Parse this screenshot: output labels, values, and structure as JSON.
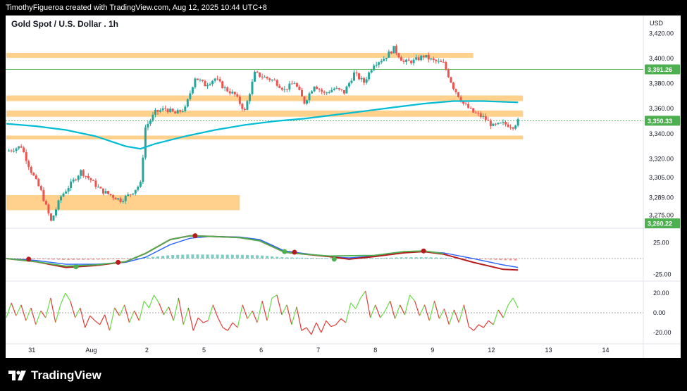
{
  "header": {
    "attribution": "TimothyFigueroa created with TradingView.com, Aug 12, 2025 10:44 UTC+8"
  },
  "footer": {
    "brand": "TradingView"
  },
  "colors": {
    "bull": "#26a69a",
    "bear": "#ef5350",
    "zone": "#ffcc80",
    "ema": "#00bcd4",
    "macd_fast": "#4caf50",
    "macd_signal": "#2962ff",
    "macd_slow": "#b71c1c",
    "osc_up": "#66dd44",
    "osc_down": "#e53935",
    "green_label": "#4caf50"
  },
  "chart_data": [
    {
      "type": "candlestick",
      "title": "Gold Spot / U.S. Dollar . 1h",
      "currency": "USD",
      "y_ticks": [
        "3,420.00",
        "3,400.00",
        "3,380.00",
        "3,360.00",
        "3,340.00",
        "3,320.00",
        "3,305.00",
        "3,289.00",
        "3,275.00"
      ],
      "price_labels": [
        {
          "text": "3,391.26",
          "value": 3391.26,
          "color": "#4caf50"
        },
        {
          "text": "3,350.33",
          "value": 3350.33,
          "color": "#4caf50"
        },
        {
          "text": "3,260.22",
          "value": 3260.22,
          "color": "#4caf50"
        }
      ],
      "x_ticks": [
        "31",
        "Aug",
        "2",
        "5",
        "6",
        "7",
        "8",
        "9",
        "12",
        "13",
        "14"
      ],
      "zones": [
        {
          "from": 3400.5,
          "to": 3404.5,
          "t_start": 0,
          "t_end": 94
        },
        {
          "from": 3366.0,
          "to": 3370.5,
          "t_start": 0,
          "t_end": 104
        },
        {
          "from": 3353.5,
          "to": 3358.5,
          "t_start": 0,
          "t_end": 104
        },
        {
          "from": 3335.5,
          "to": 3338.5,
          "t_start": 0,
          "t_end": 104
        },
        {
          "from": 3279.0,
          "to": 3291.0,
          "t_start": 0,
          "t_end": 47
        }
      ],
      "hlines": [
        {
          "value": 3391.26
        },
        {
          "value": 3350.33
        }
      ],
      "candles": {
        "waypoints": [
          [
            0,
            3326
          ],
          [
            3,
            3330
          ],
          [
            5,
            3310
          ],
          [
            7,
            3294
          ],
          [
            9,
            3270
          ],
          [
            11,
            3290
          ],
          [
            13,
            3300
          ],
          [
            15,
            3310
          ],
          [
            17,
            3303
          ],
          [
            19,
            3295
          ],
          [
            21,
            3291
          ],
          [
            23,
            3287
          ],
          [
            25,
            3292
          ],
          [
            27,
            3300
          ],
          [
            28,
            3345
          ],
          [
            30,
            3357
          ],
          [
            32,
            3360
          ],
          [
            34,
            3356
          ],
          [
            36,
            3360
          ],
          [
            38,
            3385
          ],
          [
            40,
            3379
          ],
          [
            42,
            3384
          ],
          [
            44,
            3376
          ],
          [
            46,
            3371
          ],
          [
            48,
            3358
          ],
          [
            50,
            3388
          ],
          [
            52,
            3385
          ],
          [
            54,
            3382
          ],
          [
            56,
            3375
          ],
          [
            58,
            3381
          ],
          [
            60,
            3365
          ],
          [
            62,
            3379
          ],
          [
            64,
            3372
          ],
          [
            66,
            3376
          ],
          [
            68,
            3373
          ],
          [
            70,
            3388
          ],
          [
            72,
            3381
          ],
          [
            74,
            3396
          ],
          [
            76,
            3400
          ],
          [
            78,
            3408
          ],
          [
            80,
            3397
          ],
          [
            82,
            3398
          ],
          [
            84,
            3402
          ],
          [
            86,
            3398
          ],
          [
            88,
            3396
          ],
          [
            90,
            3377
          ],
          [
            92,
            3364
          ],
          [
            94,
            3357
          ],
          [
            96,
            3353
          ],
          [
            98,
            3346
          ],
          [
            100,
            3348
          ],
          [
            102,
            3346
          ],
          [
            103,
            3350
          ]
        ]
      },
      "ema": [
        [
          0,
          3348
        ],
        [
          6,
          3346
        ],
        [
          12,
          3343
        ],
        [
          18,
          3338
        ],
        [
          24,
          3330
        ],
        [
          27,
          3328
        ],
        [
          30,
          3332
        ],
        [
          36,
          3338
        ],
        [
          42,
          3343
        ],
        [
          48,
          3347
        ],
        [
          54,
          3350
        ],
        [
          60,
          3352
        ],
        [
          66,
          3355
        ],
        [
          72,
          3358
        ],
        [
          78,
          3361
        ],
        [
          84,
          3364
        ],
        [
          90,
          3366
        ],
        [
          96,
          3366
        ],
        [
          103,
          3365
        ]
      ]
    },
    {
      "type": "line",
      "name": "macd",
      "y_ticks": [
        "25.00",
        "-25.00"
      ],
      "zero_line": 0,
      "fast": [
        [
          0,
          0
        ],
        [
          6,
          -5
        ],
        [
          12,
          -12
        ],
        [
          18,
          -10
        ],
        [
          24,
          -5
        ],
        [
          28,
          8
        ],
        [
          33,
          30
        ],
        [
          37,
          36
        ],
        [
          41,
          35
        ],
        [
          47,
          33
        ],
        [
          51,
          28
        ],
        [
          56,
          10
        ],
        [
          60,
          7
        ],
        [
          65,
          4
        ],
        [
          69,
          0
        ],
        [
          74,
          5
        ],
        [
          80,
          11
        ],
        [
          84,
          12
        ],
        [
          88,
          8
        ],
        [
          94,
          -3
        ],
        [
          100,
          -14
        ],
        [
          103,
          -17
        ]
      ],
      "signal": [
        [
          0,
          0
        ],
        [
          6,
          -3
        ],
        [
          12,
          -9
        ],
        [
          18,
          -9
        ],
        [
          24,
          -6
        ],
        [
          28,
          2
        ],
        [
          33,
          22
        ],
        [
          37,
          32
        ],
        [
          41,
          35
        ],
        [
          47,
          34
        ],
        [
          51,
          30
        ],
        [
          56,
          12
        ],
        [
          60,
          8
        ],
        [
          65,
          3
        ],
        [
          69,
          1
        ],
        [
          74,
          4
        ],
        [
          80,
          9
        ],
        [
          84,
          11
        ],
        [
          88,
          9
        ],
        [
          94,
          0
        ],
        [
          100,
          -10
        ],
        [
          103,
          -14
        ]
      ],
      "slow": [
        [
          0,
          0
        ],
        [
          6,
          -5
        ],
        [
          12,
          -14
        ],
        [
          18,
          -11
        ],
        [
          24,
          -5
        ],
        [
          28,
          8
        ],
        [
          33,
          30
        ],
        [
          37,
          36
        ],
        [
          41,
          35
        ],
        [
          47,
          33
        ],
        [
          51,
          28
        ],
        [
          56,
          10
        ],
        [
          60,
          7
        ],
        [
          65,
          3
        ],
        [
          69,
          -1
        ],
        [
          74,
          3
        ],
        [
          80,
          9
        ],
        [
          84,
          11
        ],
        [
          88,
          7
        ],
        [
          94,
          -6
        ],
        [
          100,
          -17
        ],
        [
          103,
          -18
        ]
      ],
      "markers": [
        {
          "t": 4.5,
          "v": -1,
          "color": "#b71c1c"
        },
        {
          "t": 14,
          "v": -13,
          "color": "#4caf50"
        },
        {
          "t": 22.5,
          "v": -6,
          "color": "#b71c1c"
        },
        {
          "t": 38,
          "v": 36,
          "color": "#b71c1c"
        },
        {
          "t": 56,
          "v": 11,
          "color": "#4caf50"
        },
        {
          "t": 58,
          "v": 10,
          "color": "#b71c1c"
        },
        {
          "t": 66,
          "v": -1,
          "color": "#4caf50"
        },
        {
          "t": 84,
          "v": 12,
          "color": "#b71c1c"
        }
      ],
      "ylim": [
        -35,
        45
      ]
    },
    {
      "type": "line",
      "name": "oscillator",
      "y_ticks": [
        "20.00",
        "0.00",
        "-20.00"
      ],
      "zero_line": 0,
      "values": [
        -5,
        10,
        -3,
        8,
        -8,
        5,
        -12,
        2,
        -5,
        15,
        -10,
        8,
        20,
        12,
        -5,
        5,
        -15,
        -3,
        -8,
        -12,
        -2,
        -18,
        5,
        -3,
        8,
        -10,
        2,
        -8,
        12,
        5,
        18,
        10,
        -2,
        6,
        -8,
        15,
        -12,
        5,
        -18,
        -5,
        -10,
        -8,
        8,
        -5,
        -15,
        -18,
        -10,
        -15,
        8,
        -6,
        2,
        -10,
        12,
        -8,
        15,
        18,
        -2,
        8,
        -12,
        6,
        -18,
        -15,
        -22,
        -10,
        -20,
        -8,
        -14,
        -12,
        -6,
        -10,
        10,
        4,
        15,
        22,
        -5,
        8,
        -5,
        2,
        12,
        -6,
        8,
        -2,
        18,
        12,
        -3,
        8,
        -8,
        12,
        -6,
        4,
        -12,
        3,
        -10,
        8,
        -14,
        -18,
        -12,
        -15,
        -8,
        -12,
        3,
        -5,
        8,
        15,
        5
      ],
      "ylim": [
        -30,
        30
      ]
    }
  ]
}
